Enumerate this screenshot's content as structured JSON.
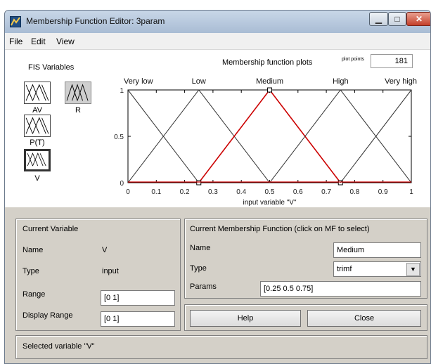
{
  "window": {
    "title": "Membership Function Editor: 3param"
  },
  "menu": [
    "File",
    "Edit",
    "View"
  ],
  "fis": {
    "label": "FIS Variables",
    "variables": [
      {
        "name": "AV",
        "kind": "input"
      },
      {
        "name": "R",
        "kind": "output"
      },
      {
        "name": "P(T)",
        "kind": "input"
      },
      {
        "name": "V",
        "kind": "input",
        "selected": true
      }
    ]
  },
  "plot": {
    "title": "Membership function plots",
    "plot_points_label": "plot points",
    "plot_points": "181",
    "xlabel": "input variable \"V\"",
    "x_ticks": [
      "0",
      "0.1",
      "0.2",
      "0.3",
      "0.4",
      "0.5",
      "0.6",
      "0.7",
      "0.8",
      "0.9",
      "1"
    ],
    "y_ticks": [
      "0",
      "0.5",
      "1"
    ]
  },
  "chart_data": {
    "type": "line",
    "xlabel": "input variable \"V\"",
    "ylabel": "",
    "xlim": [
      0,
      1
    ],
    "ylim": [
      0,
      1
    ],
    "series": [
      {
        "name": "Very low",
        "x": [
          -0.25,
          0,
          0.25
        ],
        "y": [
          0,
          1,
          0
        ]
      },
      {
        "name": "Low",
        "x": [
          0,
          0.25,
          0.5
        ],
        "y": [
          0,
          1,
          0
        ]
      },
      {
        "name": "Medium",
        "x": [
          0.25,
          0.5,
          0.75
        ],
        "y": [
          0,
          1,
          0
        ],
        "highlighted": true
      },
      {
        "name": "High",
        "x": [
          0.5,
          0.75,
          1
        ],
        "y": [
          0,
          1,
          0
        ]
      },
      {
        "name": "Very high",
        "x": [
          0.75,
          1,
          1.25
        ],
        "y": [
          0,
          1,
          0
        ]
      }
    ],
    "mf_labels": [
      {
        "text": "Very low",
        "x": 0.0
      },
      {
        "text": "Low",
        "x": 0.25
      },
      {
        "text": "Medium",
        "x": 0.5
      },
      {
        "text": "High",
        "x": 0.75
      },
      {
        "text": "Very high",
        "x": 1.0
      }
    ]
  },
  "current_variable": {
    "heading": "Current Variable",
    "name_label": "Name",
    "name_value": "V",
    "type_label": "Type",
    "type_value": "input",
    "range_label": "Range",
    "range_value": "[0 1]",
    "display_range_label": "Display Range",
    "display_range_value": "[0 1]"
  },
  "current_mf": {
    "heading": "Current Membership Function (click on MF to select)",
    "name_label": "Name",
    "name_value": "Medium",
    "type_label": "Type",
    "type_value": "trimf",
    "params_label": "Params",
    "params_value": "[0.25 0.5 0.75]"
  },
  "buttons": {
    "help": "Help",
    "close": "Close"
  },
  "status": "Selected variable \"V\"",
  "colors": {
    "selected_mf": "#cc0000",
    "mf_line": "#333333"
  }
}
